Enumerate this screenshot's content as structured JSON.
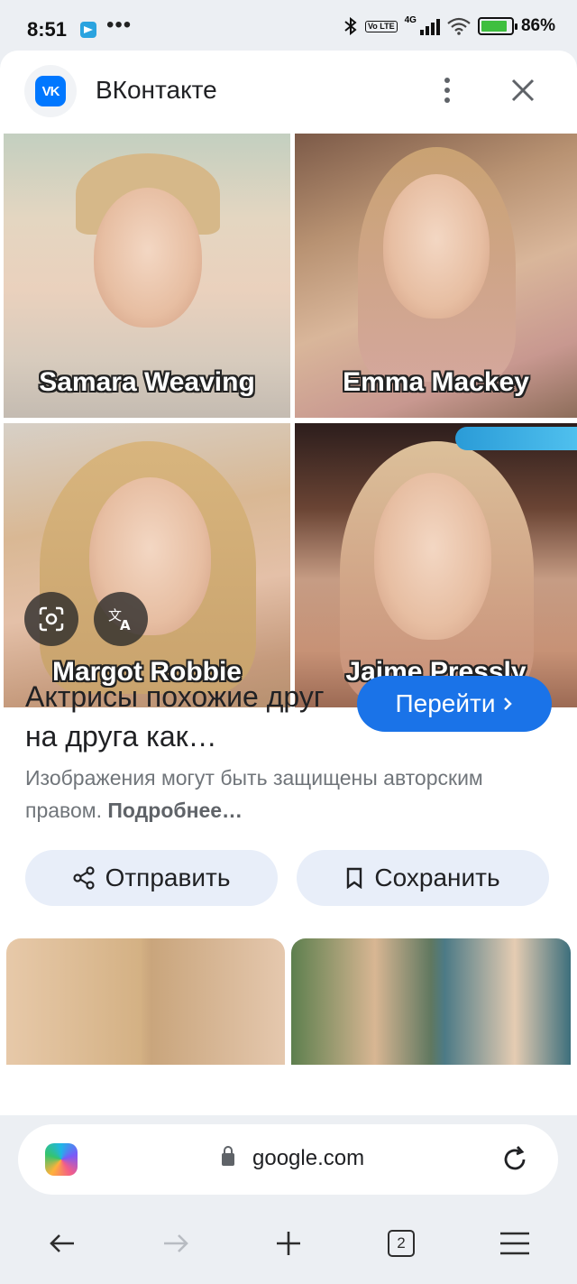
{
  "status_bar": {
    "time": "8:51",
    "overflow_indicator": "•••",
    "network_label": "4G",
    "volte_label": "Vo LTE",
    "battery_percent": "86%"
  },
  "sheet": {
    "site_name": "ВКонтакте",
    "site_logo_text": "VK"
  },
  "image_grid": {
    "captions": [
      "Samara Weaving",
      "Emma Mackey",
      "Margot Robbie",
      "Jaime Pressly"
    ]
  },
  "result": {
    "title": "Актрисы похожие друг на друга как…",
    "goto_label": "Перейти",
    "copyright_text": "Изображения могут быть защищены авторским правом.",
    "learn_more": "Подробнее…",
    "share_label": "Отправить",
    "save_label": "Сохранить"
  },
  "address_bar": {
    "url": "google.com"
  },
  "bottom_nav": {
    "tab_count": "2"
  },
  "colors": {
    "accent": "#1a73e8",
    "vk_blue": "#0077ff",
    "chip_bg": "#e8eef9"
  }
}
